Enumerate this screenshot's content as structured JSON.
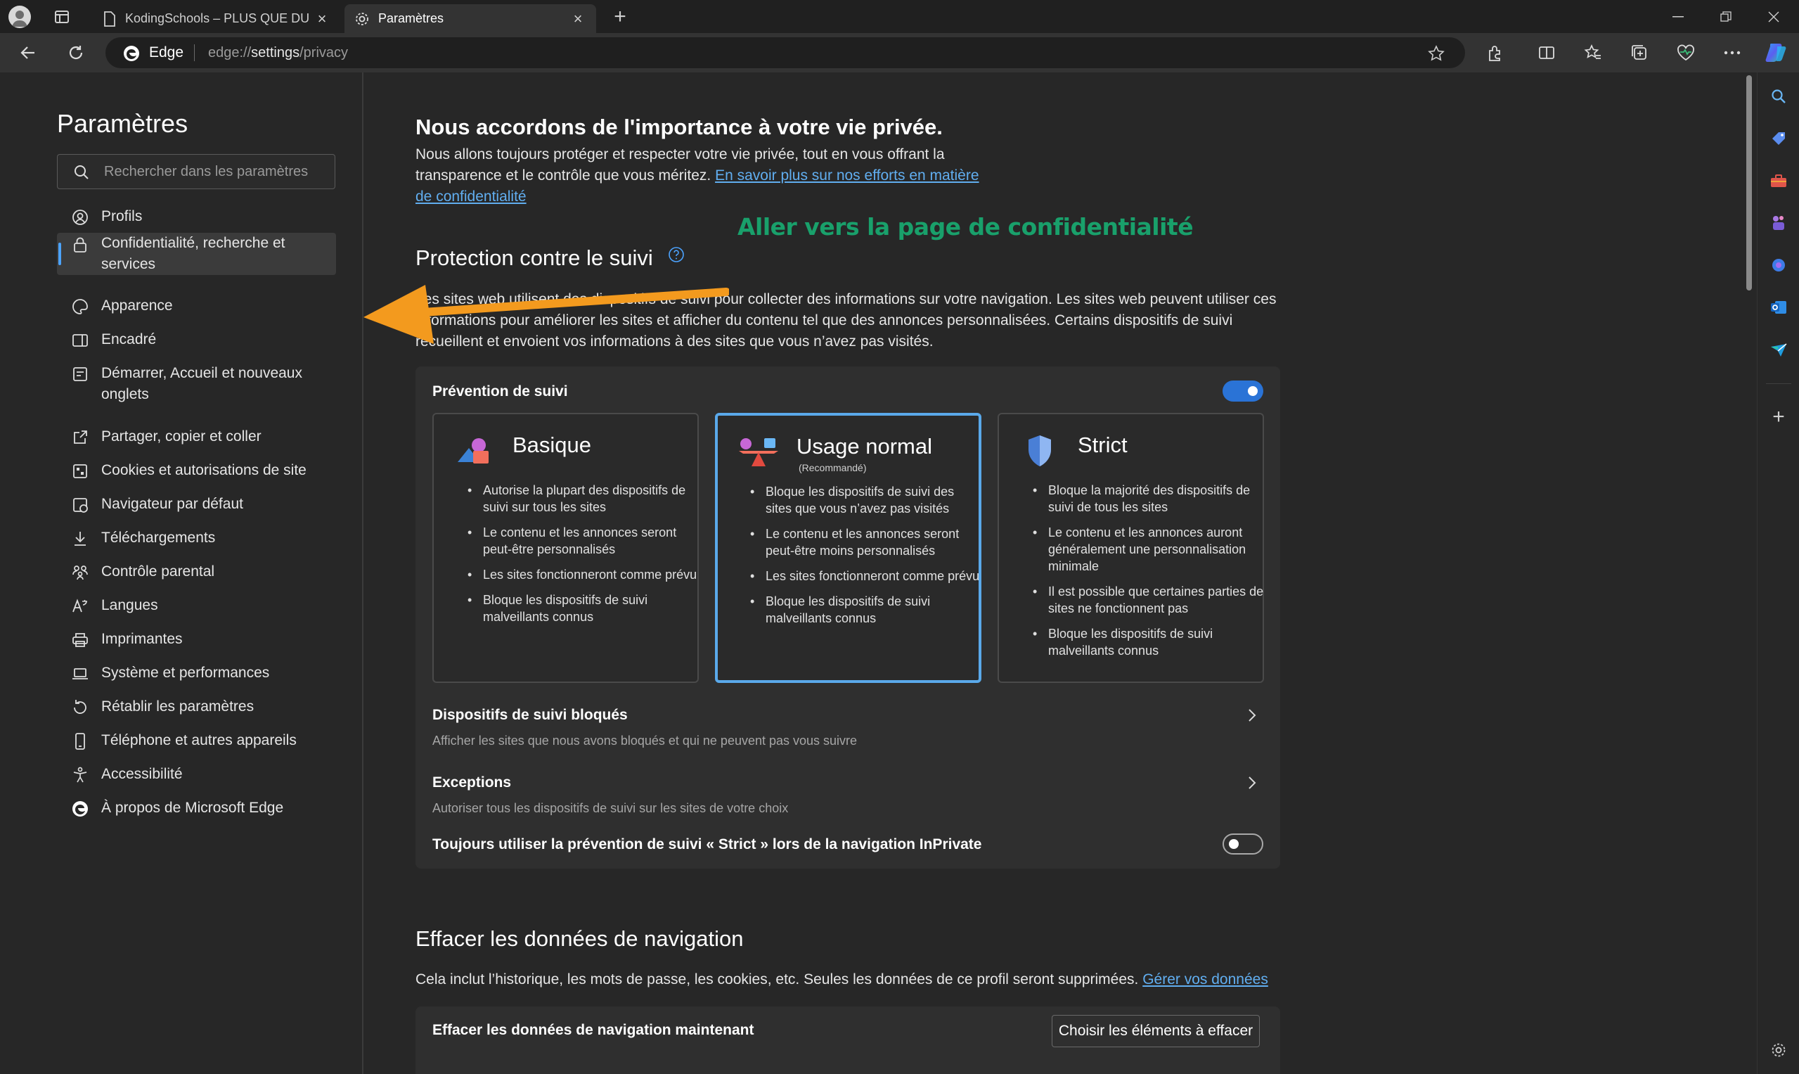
{
  "tabs": [
    {
      "title": "KodingSchools – PLUS QUE DU C",
      "active": false
    },
    {
      "title": "Paramètres",
      "active": true
    }
  ],
  "address": {
    "brand": "Edge",
    "url_prefix": "edge://",
    "url_host": "settings",
    "url_path": "/privacy"
  },
  "sidebar": {
    "title": "Paramètres",
    "search_placeholder": "Rechercher dans les paramètres",
    "items": [
      {
        "label": "Profils",
        "icon": "profile-icon"
      },
      {
        "label": "Confidentialité, recherche et services",
        "icon": "lock-icon",
        "active": true
      },
      {
        "label": "Apparence",
        "icon": "appearance-icon"
      },
      {
        "label": "Encadré",
        "icon": "sidebar-panel-icon"
      },
      {
        "label": "Démarrer, Accueil et nouveaux onglets",
        "icon": "home-icon"
      },
      {
        "label": "Partager, copier et coller",
        "icon": "share-icon"
      },
      {
        "label": "Cookies et autorisations de site",
        "icon": "cookies-icon"
      },
      {
        "label": "Navigateur par défaut",
        "icon": "default-browser-icon"
      },
      {
        "label": "Téléchargements",
        "icon": "download-icon"
      },
      {
        "label": "Contrôle parental",
        "icon": "family-icon"
      },
      {
        "label": "Langues",
        "icon": "language-icon"
      },
      {
        "label": "Imprimantes",
        "icon": "printer-icon"
      },
      {
        "label": "Système et performances",
        "icon": "laptop-icon"
      },
      {
        "label": "Rétablir les paramètres",
        "icon": "reset-icon"
      },
      {
        "label": "Téléphone et autres appareils",
        "icon": "phone-icon"
      },
      {
        "label": "Accessibilité",
        "icon": "accessibility-icon"
      },
      {
        "label": "À propos de Microsoft Edge",
        "icon": "edge-icon"
      }
    ]
  },
  "privacy": {
    "title": "Nous accordons de l'importance à votre vie privée.",
    "text": "Nous allons toujours protéger et respecter votre vie privée, tout en vous offrant la transparence et le contrôle que vous méritez.",
    "link": "En savoir plus sur nos efforts en matière de confidentialité"
  },
  "annotation": "Aller vers la page de confidentialité",
  "tracking": {
    "title": "Protection contre le suivi",
    "description": "Les sites web utilisent des dispositifs de suivi pour collecter des informations sur votre navigation. Les sites web peuvent utiliser ces informations pour améliorer les sites et afficher du contenu tel que des annonces personnalisées. Certains dispositifs de suivi recueillent et envoient vos informations à des sites que vous n’avez pas visités.",
    "prevention_label": "Prévention de suivi",
    "prevention_on": true,
    "modes": [
      {
        "name": "Basique",
        "sub": "",
        "selected": false,
        "bullets": [
          "Autorise la plupart des dispositifs de suivi sur tous les sites",
          "Le contenu et les annonces seront peut-être personnalisés",
          "Les sites fonctionneront comme prévu",
          "Bloque les dispositifs de suivi malveillants connus"
        ]
      },
      {
        "name": "Usage normal",
        "sub": "(Recommandé)",
        "selected": true,
        "bullets": [
          "Bloque les dispositifs de suivi des sites que vous n’avez pas visités",
          "Le contenu et les annonces seront peut-être moins personnalisés",
          "Les sites fonctionneront comme prévu",
          "Bloque les dispositifs de suivi malveillants connus"
        ]
      },
      {
        "name": "Strict",
        "sub": "",
        "selected": false,
        "bullets": [
          "Bloque la majorité des dispositifs de suivi de tous les sites",
          "Le contenu et les annonces auront généralement une personnalisation minimale",
          "Il est possible que certaines parties de sites ne fonctionnent pas",
          "Bloque les dispositifs de suivi malveillants connus"
        ]
      }
    ],
    "blocked_title": "Dispositifs de suivi bloqués",
    "blocked_sub": "Afficher les sites que nous avons bloqués et qui ne peuvent pas vous suivre",
    "exceptions_title": "Exceptions",
    "exceptions_sub": "Autoriser tous les dispositifs de suivi sur les sites de votre choix",
    "inprivate_label": "Toujours utiliser la prévention de suivi « Strict » lors de la navigation InPrivate",
    "inprivate_on": false
  },
  "clear": {
    "title": "Effacer les données de navigation",
    "text": "Cela inclut l’historique, les mots de passe, les cookies, etc. Seules les données de ce profil seront supprimées.",
    "link": "Gérer vos données",
    "row_label": "Effacer les données de navigation maintenant",
    "button": "Choisir les éléments à effacer"
  },
  "colors": {
    "accent": "#2a73d6",
    "link": "#61aef0",
    "annotation": "#19a06b",
    "arrow": "#f39a1e"
  }
}
